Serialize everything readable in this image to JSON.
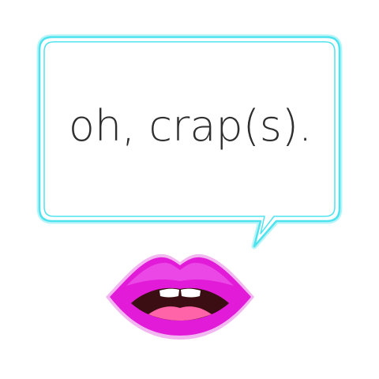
{
  "caption": {
    "text": "oh, crap(s)."
  },
  "colors": {
    "background": "#ffffff",
    "bubble_outline": "#4fe3ef",
    "bubble_glow": "#b8f4f8",
    "text": "#2f2f2f",
    "lips_main": "#e21bd9",
    "lips_light": "#f36cf0",
    "lips_edge": "#f2b7f0",
    "mouth_dark": "#3a0e12",
    "tongue": "#ff63a8",
    "teeth": "#ffffff"
  },
  "icons": {
    "speech_bubble": "speech-bubble-icon",
    "lips": "lips-icon"
  }
}
